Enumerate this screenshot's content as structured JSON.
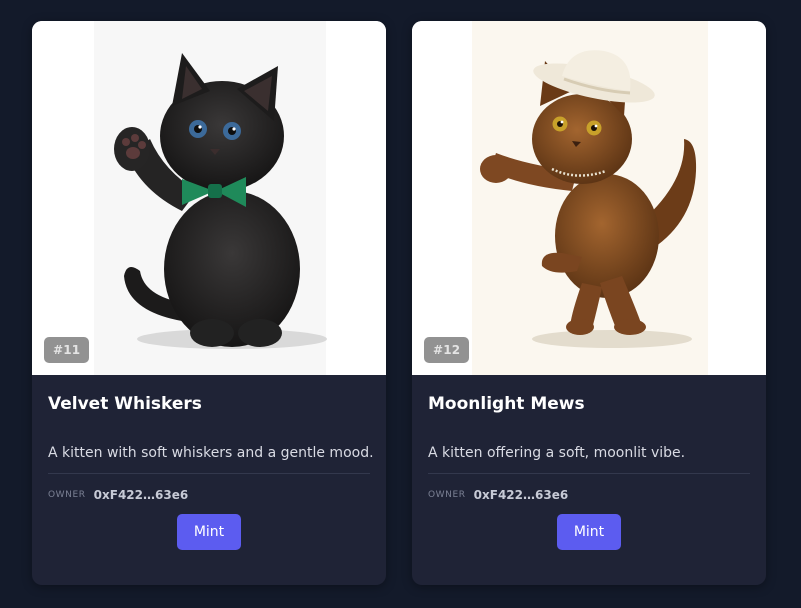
{
  "colors": {
    "page_background": "#131a2a",
    "card_background": "#1f2336",
    "button_primary": "#5c5cf0"
  },
  "cards": [
    {
      "token": "#11",
      "title": "Velvet Whiskers",
      "description": "A kitten with soft whiskers and a gentle mood.",
      "owner_label": "OWNER",
      "owner_address": "0xF422…63e6",
      "mint_label": "Mint",
      "image_subject": "black kitten waving with green bow tie"
    },
    {
      "token": "#12",
      "title": "Moonlight Mews",
      "description": "A kitten offering a soft, moonlit vibe.",
      "owner_label": "OWNER",
      "owner_address": "0xF422…63e6",
      "mint_label": "Mint",
      "image_subject": "brown kitten in white cowboy hat dancing"
    }
  ]
}
